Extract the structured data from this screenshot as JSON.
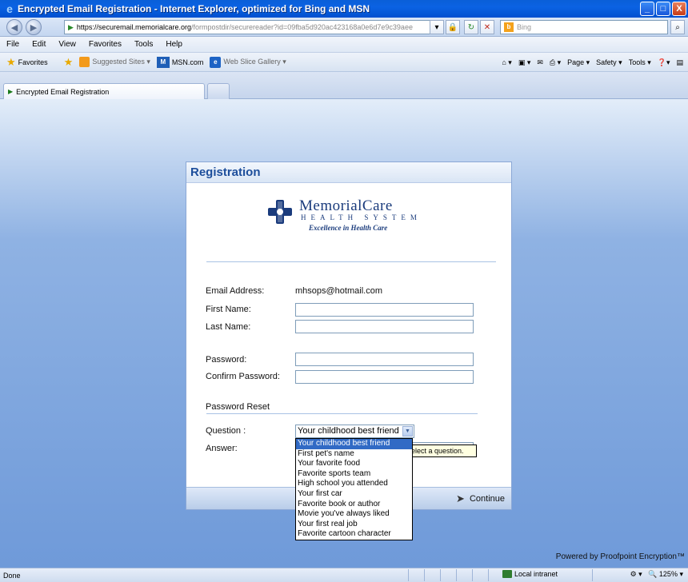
{
  "window": {
    "title": "Encrypted Email Registration - Internet Explorer, optimized for Bing and MSN",
    "buttons": {
      "minimize": "_",
      "maximize": "□",
      "close": "X"
    }
  },
  "address_bar": {
    "url_host": "https://securemail.memorialcare.org",
    "url_path": "/formpostdir/securereader?id=09fba5d920ac423168a0e6d7e9c39aee",
    "search_placeholder": "Bing"
  },
  "menu": [
    "File",
    "Edit",
    "View",
    "Favorites",
    "Tools",
    "Help"
  ],
  "favorites_bar": {
    "favorites_label": "Favorites",
    "items": [
      "Suggested Sites ▾",
      "MSN.com",
      "Web Slice Gallery ▾"
    ],
    "commands": [
      "Page ▾",
      "Safety ▾",
      "Tools ▾"
    ]
  },
  "tab": {
    "label": "Encrypted Email Registration"
  },
  "panel": {
    "title": "Registration",
    "logo": {
      "name": "MemorialCare",
      "sub": "HEALTH SYSTEM",
      "tagline": "Excellence in Health Care"
    },
    "email_label": "Email Address:",
    "email_value": "mhsops@hotmail.com",
    "first_name_label": "First Name:",
    "last_name_label": "Last Name:",
    "password_label": "Password:",
    "confirm_password_label": "Confirm Password:",
    "password_reset_heading": "Password Reset",
    "question_label": "Question :",
    "question_selected": "Your childhood best friend",
    "answer_label": "Answer:",
    "tooltip": "Select a question.",
    "continue_label": "Continue"
  },
  "dropdown": {
    "options": [
      "Your childhood best friend",
      "First pet's name",
      "Your favorite food",
      "Favorite sports team",
      "High school you attended",
      "Your first car",
      "Favorite book or author",
      "Movie you've always liked",
      "Your first real job",
      "Favorite cartoon character"
    ]
  },
  "powered_by": "Powered by Proofpoint Encryption™",
  "status": {
    "text": "Done",
    "zone": "Local intranet",
    "zoom": "125%"
  }
}
